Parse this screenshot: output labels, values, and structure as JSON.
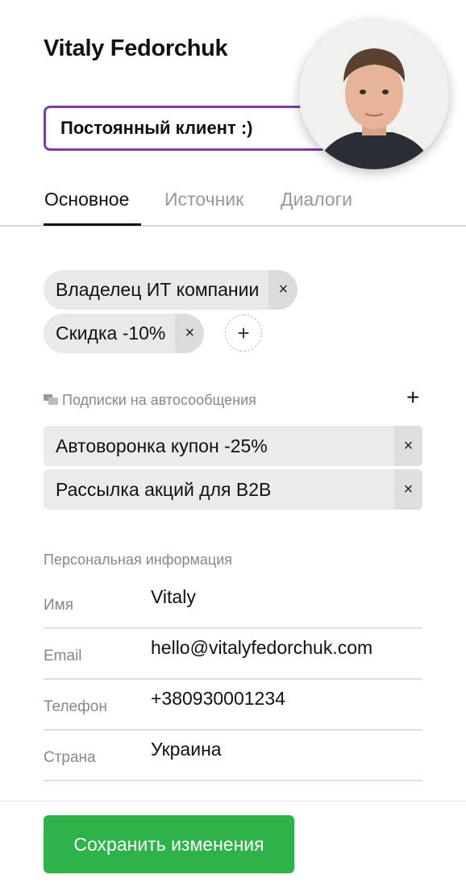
{
  "profile": {
    "name": "Vitaly Fedorchuk",
    "note": "Постоянный клиент :)"
  },
  "tabs": [
    {
      "label": "Основное",
      "active": true
    },
    {
      "label": "Источник",
      "active": false
    },
    {
      "label": "Диалоги",
      "active": false
    }
  ],
  "tags": [
    {
      "label": "Владелец ИТ компании",
      "remove": "×"
    },
    {
      "label": "Скидка -10%",
      "remove": "×"
    }
  ],
  "tag_add": "+",
  "subscriptions": {
    "heading": "Подписки на автосообщения",
    "add": "+",
    "items": [
      {
        "label": "Автоворонка купон -25%",
        "remove": "×"
      },
      {
        "label": "Рассылка акций для B2B",
        "remove": "×"
      }
    ]
  },
  "personal": {
    "heading": "Персональная информация",
    "fields": [
      {
        "label": "Имя",
        "value": "Vitaly"
      },
      {
        "label": "Email",
        "value": "hello@vitalyfedorchuk.com"
      },
      {
        "label": "Телефон",
        "value": "+380930001234"
      },
      {
        "label": "Страна",
        "value": "Украина"
      }
    ]
  },
  "save_button": "Сохранить изменения",
  "colors": {
    "accent_border": "#7a3fa5",
    "save_green": "#2db34a",
    "tag_bg": "#e9e9e9"
  }
}
